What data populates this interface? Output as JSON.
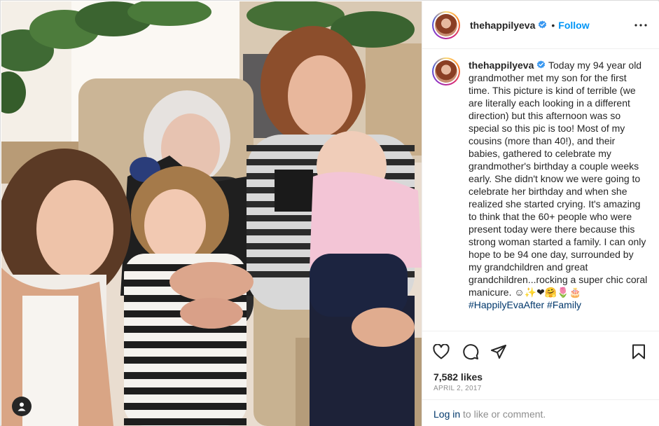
{
  "post": {
    "username": "thehappilyeva",
    "follow_label": "Follow",
    "separator": "•",
    "caption_body": "Today my 94 year old grandmother met my son for the first time. This picture is kind of terrible (we are literally each looking in a different direction) but this afternoon was so special so this pic is too! Most of my cousins (more than 40!), and their babies, gathered to celebrate my grandmother's birthday a couple weeks early. She didn't know we were going to celebrate her birthday and when she realized she started crying. It's amazing to think that the 60+ people who were present today were there because this strong woman started a family. I can only hope to be 94 one day, surrounded by my grandchildren and great grandchildren...rocking a super chic coral manicure. ☺✨❤🤗🌷🎂",
    "caption_tags": "#HappilyEvaAfter #Family",
    "likes": "7,582 likes",
    "date": "APRIL 2, 2017",
    "login_link": "Log in",
    "login_suffix": " to like or comment."
  },
  "colors": {
    "link_blue": "#0095f6",
    "dark_link": "#00376b",
    "text": "#262626",
    "muted": "#8e8e8e",
    "verified_blue": "#3897f0"
  },
  "icons": [
    "verified-badge-icon",
    "more-options-icon",
    "heart-icon",
    "comment-icon",
    "share-icon",
    "bookmark-icon",
    "user-tag-icon"
  ]
}
